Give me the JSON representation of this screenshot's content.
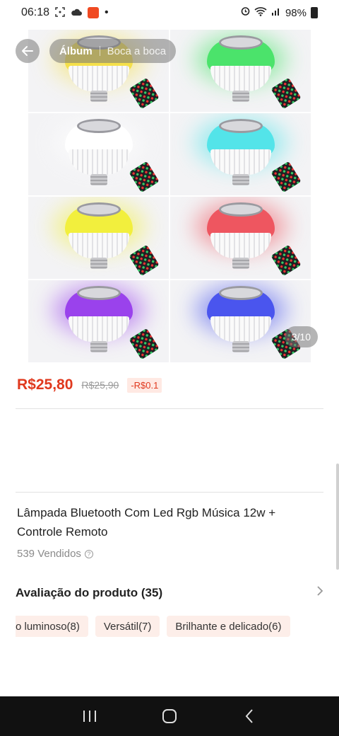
{
  "status_bar": {
    "time": "06:18",
    "dot": "•",
    "battery": "98%",
    "icons": [
      "screenshot-icon",
      "cloud-icon",
      "app-notification-icon",
      "alarm-icon",
      "wifi-icon",
      "signal-icon",
      "battery-icon"
    ]
  },
  "gallery": {
    "tabs": [
      {
        "label": "Álbum",
        "active": true
      },
      {
        "label": "Boca a boca",
        "active": false
      }
    ],
    "counter": "3/10",
    "bulb_colors": [
      "#f5e04a",
      "#4be36b",
      "#ffffff",
      "#53e4e9",
      "#f2ef3d",
      "#ee5660",
      "#9a42ec",
      "#4a55ee"
    ]
  },
  "product": {
    "price": "R$25,80",
    "old_price": "R$25,90",
    "discount": "-R$0.1",
    "title": "Lâmpada Bluetooth Com Led Rgb Música 12w + Controle Remoto",
    "sold": "539 Vendidos"
  },
  "reviews": {
    "title": "Avaliação do produto (35)",
    "tags": [
      "o luminoso(8)",
      "Versátil(7)",
      "Brilhante e delicado(6)"
    ]
  },
  "colors": {
    "accent": "#e0391e",
    "chip_bg": "#fdeee9"
  }
}
